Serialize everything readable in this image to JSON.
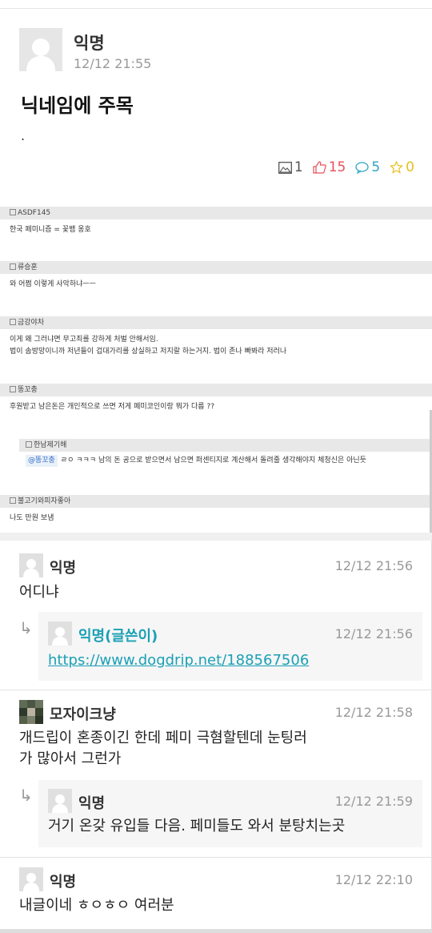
{
  "post": {
    "author": "익명",
    "date": "12/12 21:55",
    "title": "닉네임에 주목",
    "body": ".",
    "stats": {
      "images": "1",
      "likes": "15",
      "comments": "5",
      "stars": "0"
    }
  },
  "screenshot": {
    "blocks": [
      {
        "name": "ASDF145",
        "lines": [
          "한국 페미니즘 = 꽃뱀 옹호"
        ]
      },
      {
        "name": "류승훈",
        "lines": [
          "와 어쩜 이렇게 사악하냐ㅡㅡ"
        ]
      },
      {
        "name": "금강야차",
        "lines": [
          "이게 왜 그러냐면 무고죄를 강하게 처벌 안해서임.",
          "법이 솜방망이니까 저년들이 겁대가리를 상실하고 저지랄 하는거지. 법이 존나 빠봐라 저러나"
        ]
      },
      {
        "name": "똥꼬충",
        "lines": [
          "후원받고 남은돈은 개인적으로 쓰면 저게 페미코인이랑 뭐가 다름 ??"
        ]
      },
      {
        "name": "한남제기해",
        "mention": "@똥꼬충",
        "lines": [
          "ㄹㅇ ㅋㅋㅋ 남의 돈 공으로 받으면서 남으면 퍼센티지로 계산해서 돌려줄 생각해야지 체청신은 아닌듯"
        ]
      },
      {
        "name": "불고기와피자좋아",
        "lines": [
          "나도 만원 보냄"
        ]
      }
    ]
  },
  "comments": [
    {
      "author": "익명",
      "date": "12/12 21:56",
      "text": "어디냐"
    },
    {
      "author": "익명(글쓴이)",
      "date": "12/12 21:56",
      "link": "https://www.dogdrip.net/188567506"
    },
    {
      "author": "모자이크냥",
      "date": "12/12 21:58",
      "lines": [
        "개드립이 혼종이긴 한데 페미 극혐할텐데 눈팅러",
        "가 많아서 그런가"
      ]
    },
    {
      "author": "익명",
      "date": "12/12 21:59",
      "text": "거기 온갖 유입들 다음. 페미들도 와서 분탕치는곳"
    },
    {
      "author": "익명",
      "date": "12/12 22:10",
      "text": "내글이네 ㅎㅇㅎㅇ 여러분"
    }
  ],
  "icons": {
    "avatar": "default-avatar-icon",
    "image": "image-icon",
    "like": "thumbs-up-icon",
    "comment": "speech-bubble-icon",
    "star": "star-icon",
    "reply": "reply-arrow-icon"
  },
  "colors": {
    "like": "#e6505b",
    "comment": "#2ea3c4",
    "star": "#e6c020",
    "op": "#1aa0b5"
  }
}
